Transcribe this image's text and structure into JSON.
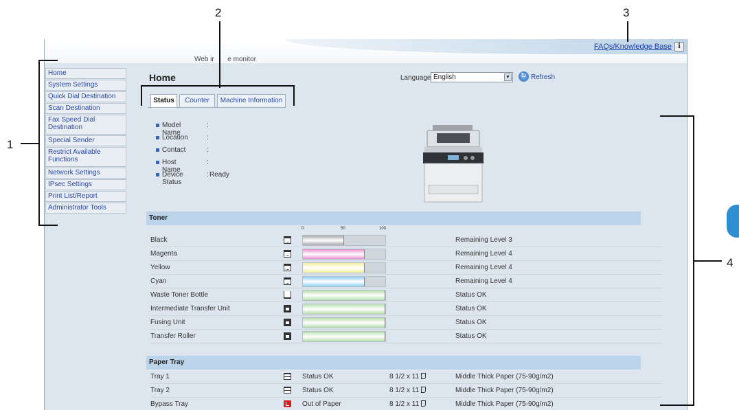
{
  "callouts": {
    "one": "1",
    "two": "2",
    "three": "3",
    "four": "4"
  },
  "header": {
    "banner_title_left": "Web ir",
    "banner_title_right": "e monitor",
    "faq_link": "FAQs/Knowledge Base",
    "info_icon": "i"
  },
  "sidebar": {
    "items": [
      {
        "label": "Home"
      },
      {
        "label": "System Settings"
      },
      {
        "label": "Quick Dial Destination"
      },
      {
        "label": "Scan Destination"
      },
      {
        "label": "Fax Speed Dial Destination"
      },
      {
        "label": "Special Sender"
      },
      {
        "label": "Restrict Available Functions"
      },
      {
        "label": "Network Settings"
      },
      {
        "label": "IPsec Settings"
      },
      {
        "label": "Print List/Report"
      },
      {
        "label": "Administrator Tools"
      }
    ]
  },
  "main": {
    "title": "Home",
    "language_label": "Language",
    "language_value": "English",
    "refresh_label": "Refresh",
    "tabs": [
      {
        "label": "Status",
        "active": true
      },
      {
        "label": "Counter",
        "active": false
      },
      {
        "label": "Machine Information",
        "active": false
      }
    ],
    "info": [
      {
        "label": "Model Name",
        "value": ""
      },
      {
        "label": "Location",
        "value": ""
      },
      {
        "label": "Contact",
        "value": ""
      },
      {
        "label": "Host Name",
        "value": ""
      },
      {
        "label": "Device Status",
        "value": "Ready"
      }
    ],
    "toner_header": "Toner",
    "scale": [
      "0",
      "50",
      "100"
    ],
    "toner": [
      {
        "name": "Black",
        "level": 0.5,
        "color": "#a9a9ad",
        "status": "Remaining Level 3",
        "icon": "toner-icon"
      },
      {
        "name": "Magenta",
        "level": 0.75,
        "color": "#ea8fc9",
        "status": "Remaining Level 4",
        "icon": "toner-icon"
      },
      {
        "name": "Yellow",
        "level": 0.75,
        "color": "#f4ef9a",
        "status": "Remaining Level 4",
        "icon": "toner-icon"
      },
      {
        "name": "Cyan",
        "level": 0.75,
        "color": "#8fd1f2",
        "status": "Remaining Level 4",
        "icon": "toner-icon"
      },
      {
        "name": "Waste Toner Bottle",
        "level": 1.0,
        "color": "#b7e0ad",
        "status": "Status OK",
        "icon": "waste-bottle-icon"
      },
      {
        "name": "Intermediate Transfer Unit",
        "level": 1.0,
        "color": "#b7e0ad",
        "status": "Status OK",
        "icon": "unit-icon"
      },
      {
        "name": "Fusing Unit",
        "level": 1.0,
        "color": "#b7e0ad",
        "status": "Status OK",
        "icon": "unit-icon"
      },
      {
        "name": "Transfer Roller",
        "level": 1.0,
        "color": "#b7e0ad",
        "status": "Status OK",
        "icon": "unit-icon"
      }
    ],
    "paper_header": "Paper Tray",
    "trays": [
      {
        "name": "Tray 1",
        "status": "Status OK",
        "size": "8 1/2 x 11",
        "type": "Middle Thick Paper (75-90g/m2)",
        "empty": false
      },
      {
        "name": "Tray 2",
        "status": "Status OK",
        "size": "8 1/2 x 11",
        "type": "Middle Thick Paper (75-90g/m2)",
        "empty": false
      },
      {
        "name": "Bypass Tray",
        "status": "Out of Paper",
        "size": "8 1/2 x 11",
        "type": "Middle Thick Paper (75-90g/m2)",
        "empty": true
      }
    ]
  },
  "colors": {
    "accent_link": "#2947a4",
    "section_header": "#bcd4ea",
    "panel_bg": "#dde6ee",
    "error": "#d81e1e"
  }
}
